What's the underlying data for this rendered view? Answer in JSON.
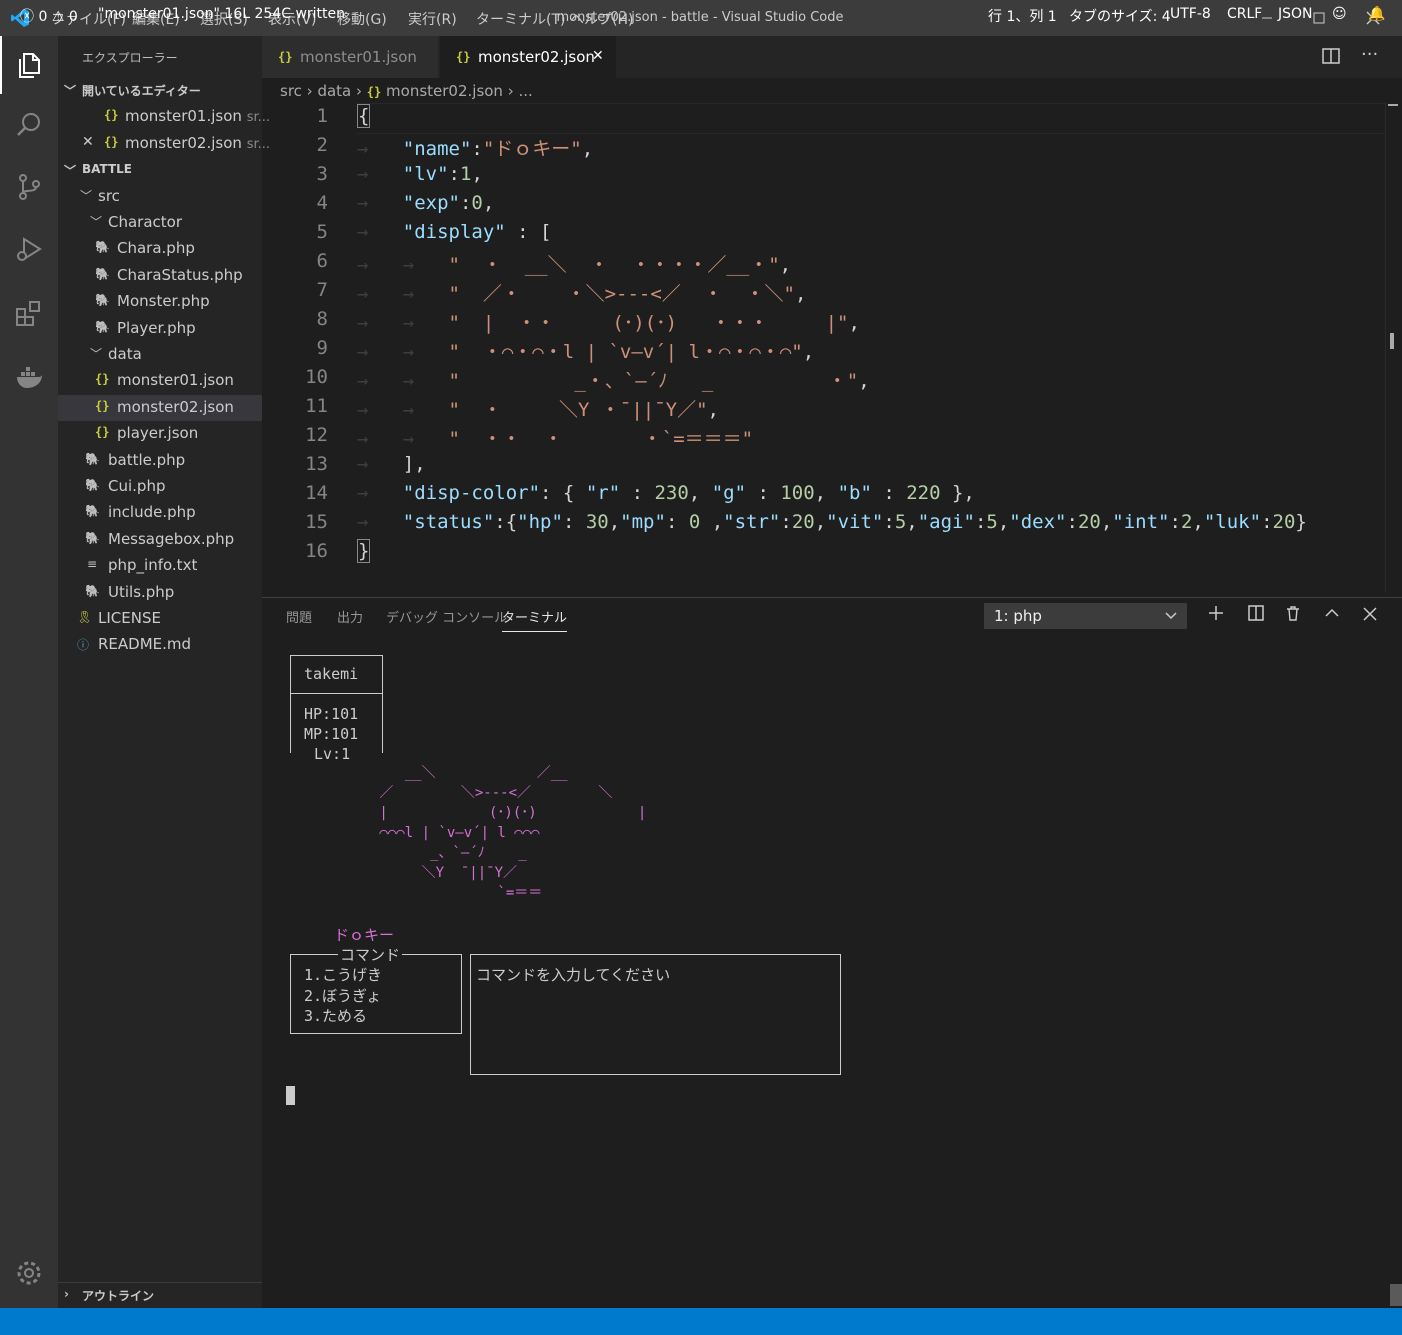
{
  "titlebar": {
    "menu": [
      "ファイル(F)",
      "編集(E)",
      "選択(S)",
      "表示(V)",
      "移動(G)",
      "実行(R)",
      "ターミナル(T)",
      "ヘルプ(H)"
    ],
    "title": "monster02.json - battle - Visual Studio Code"
  },
  "sidebar": {
    "title": "エクスプローラー",
    "open_editors": "開いているエディター",
    "open_files": [
      {
        "name": "monster01.json",
        "desc": "sr..."
      },
      {
        "name": "monster02.json",
        "desc": "sr..."
      }
    ],
    "project": "BATTLE",
    "tree": {
      "src": "src",
      "charactor": "Charactor",
      "chara_files": [
        "Chara.php",
        "CharaStatus.php",
        "Monster.php",
        "Player.php"
      ],
      "data": "data",
      "data_files": [
        "monster01.json",
        "monster02.json",
        "player.json"
      ],
      "src_files": [
        "battle.php",
        "Cui.php",
        "include.php",
        "Messagebox.php",
        "php_info.txt",
        "Utils.php"
      ],
      "root_files": [
        "LICENSE",
        "README.md"
      ]
    },
    "outline": "アウトライン"
  },
  "tabs": [
    {
      "label": "monster01.json",
      "active": false
    },
    {
      "label": "monster02.json",
      "active": true
    }
  ],
  "breadcrumb": {
    "parts": [
      "src",
      "data",
      "monster02.json",
      "..."
    ]
  },
  "editor": {
    "line_numbers": [
      "1",
      "2",
      "3",
      "4",
      "5",
      "6",
      "7",
      "8",
      "9",
      "10",
      "11",
      "12",
      "13",
      "14",
      "15",
      "16"
    ],
    "line1": "{",
    "name_key": "\"name\"",
    "name_val": "\"ドｏキー\"",
    "lv_key": "\"lv\"",
    "lv_val": "1",
    "exp_key": "\"exp\"",
    "exp_val": "0",
    "display_key": "\"display\"",
    "display_lines": [
      "\"  ・  __＼  ・  ・・・・／__・\"",
      "\"  ／・    ・＼>---<／  ・  ・＼\"",
      "\"  |  ・・     (･)(･)   ・・・     |\"",
      "\"  ・⌒・⌒・l | `v—v´| l・⌒・⌒・⌒\"",
      "\"          _・、`—´ﾉ   _          ・\"",
      "\"  ・     ＼Y ・¯||¯Y／\"",
      "\"  ・・  ・       ・`=＝＝＝\""
    ],
    "line13": "],",
    "disp_color_key": "\"disp-color\"",
    "r_key": "\"r\"",
    "r_val": "230",
    "g_key": "\"g\"",
    "g_val": "100",
    "b_key": "\"b\"",
    "b_val": "220",
    "status_key": "\"status\"",
    "status_items": [
      {
        "k": "\"hp\"",
        "v": " 30"
      },
      {
        "k": "\"mp\"",
        "v": " 0 "
      },
      {
        "k": "\"str\"",
        "v": "20"
      },
      {
        "k": "\"vit\"",
        "v": "5"
      },
      {
        "k": "\"agi\"",
        "v": "5"
      },
      {
        "k": "\"dex\"",
        "v": "20"
      },
      {
        "k": "\"int\"",
        "v": "2"
      },
      {
        "k": "\"luk\"",
        "v": "20"
      }
    ],
    "line16": "}"
  },
  "panel": {
    "tabs": [
      "問題",
      "出力",
      "デバッグ コンソール",
      "ターミナル"
    ],
    "terminal_select": "1: php"
  },
  "terminal": {
    "player_name": "takemi",
    "hp": "HP:101",
    "mp": "MP:101",
    "lv": "Lv:1",
    "monster_art": [
      "           __＼            ／__",
      "        ／        ＼>---<／        ＼",
      "        |            (･)(･)            |",
      "        ⌒⌒⌒l | `v—v´| l ⌒⌒⌒",
      "              _、`—´ﾉ    _",
      "             ＼Y  ¯||¯Y／",
      "                      `=＝＝"
    ],
    "monster_name": "ドｏキー",
    "command_title": "コマンド",
    "commands": [
      "1.こうげき",
      "2.ぼうぎょ",
      "3.ためる"
    ],
    "message": "コマンドを入力してください"
  },
  "statusbar": {
    "errors": "0",
    "warnings": "0",
    "message": "\"monster01.json\" 16L 254C written",
    "position": "行 1、列 1",
    "tab_size": "タブのサイズ: 4",
    "encoding": "UTF-8",
    "eol": "CRLF",
    "language": "JSON"
  },
  "colors": {
    "statusbar": "#007acc",
    "monster": "#d670d6",
    "json_key": "#9cdcfe",
    "json_string": "#ce9178",
    "json_number": "#b5cea8"
  }
}
